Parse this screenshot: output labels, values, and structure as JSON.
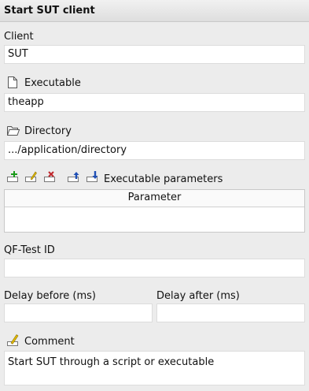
{
  "title": "Start SUT client",
  "client": {
    "label": "Client",
    "value": "SUT"
  },
  "executable": {
    "label": "Executable",
    "value": "theapp"
  },
  "directory": {
    "label": "Directory",
    "value": ".../application/directory"
  },
  "parameters": {
    "label": "Executable parameters",
    "column_header": "Parameter",
    "rows": []
  },
  "qftest_id": {
    "label": "QF-Test ID",
    "value": ""
  },
  "delay_before": {
    "label": "Delay before (ms)",
    "value": ""
  },
  "delay_after": {
    "label": "Delay after (ms)",
    "value": ""
  },
  "comment": {
    "label": "Comment",
    "value": "Start SUT through a script or executable"
  },
  "icons": [
    "file-icon",
    "folder-icon",
    "add-row-icon",
    "edit-row-icon",
    "delete-row-icon",
    "move-up-icon",
    "move-down-icon",
    "pencil-icon"
  ],
  "colors": {
    "add": "#1a9a1a",
    "delete": "#c0262c",
    "move": "#1f4fb5",
    "pencil": "#d8b100"
  }
}
